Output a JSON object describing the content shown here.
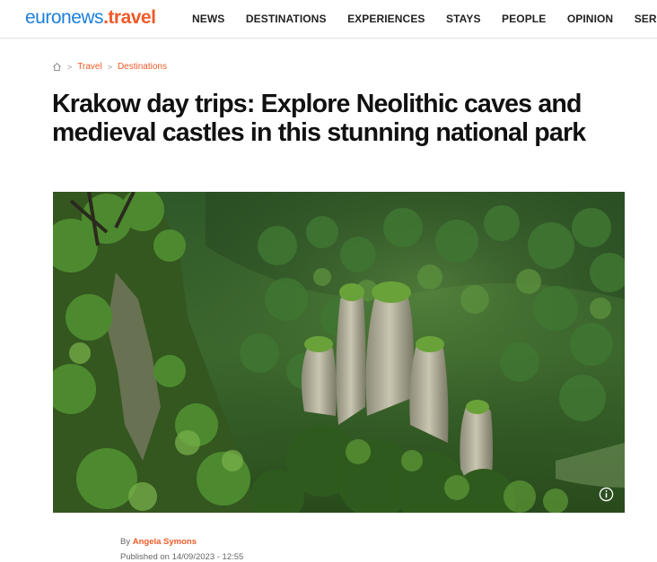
{
  "header": {
    "logo_brand": "euronews",
    "logo_section": ".travel",
    "nav": [
      "NEWS",
      "DESTINATIONS",
      "EXPERIENCES",
      "STAYS",
      "PEOPLE",
      "OPINION",
      "SERIES"
    ]
  },
  "breadcrumb": {
    "items": [
      "Travel",
      "Destinations"
    ]
  },
  "article": {
    "title": "Krakow day trips: Explore Neolithic caves and medieval castles in this stunning national park",
    "byline_prefix": "By",
    "author": "Angela Symons",
    "published": "Published on 14/09/2023 - 12:55"
  },
  "icons": {
    "home": "home-icon",
    "chevron": "chevron-down-icon",
    "info": "info-icon"
  },
  "colors": {
    "brand_blue": "#1c7fdb",
    "accent_orange": "#f05a28"
  }
}
